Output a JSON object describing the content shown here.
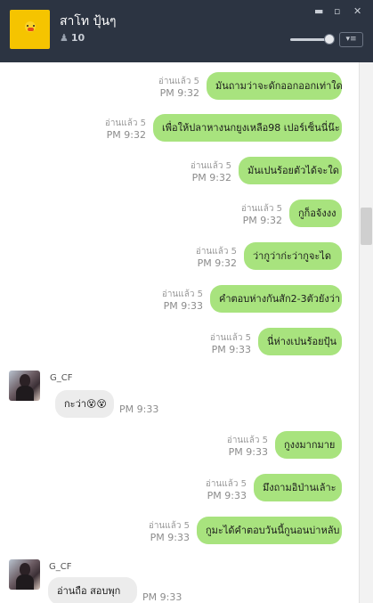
{
  "header": {
    "title": "สาโท ปุ้นๆ",
    "member_count": "10",
    "window_controls": [
      "▬",
      "▫",
      "✕"
    ]
  },
  "messages": [
    {
      "side": "me",
      "text": "มันถามว่าจะดักออกออกเท่าใด",
      "read": "อ่านแล้ว 5",
      "time": "PM 9:32"
    },
    {
      "side": "me",
      "text": "เพื่อให้ปลาหางนกยูงเหลือ98 เปอร์เซ็นนี่น๊ะ",
      "read": "อ่านแล้ว 5",
      "time": "PM 9:32"
    },
    {
      "side": "me",
      "text": "มันเปนร้อยตัวได้จะใด",
      "read": "อ่านแล้ว 5",
      "time": "PM 9:32"
    },
    {
      "side": "me",
      "text": "กูก็อจ้งงง",
      "read": "อ่านแล้ว 5",
      "time": "PM 9:32"
    },
    {
      "side": "me",
      "text": "ว่ากูว่าก่ะว่ากูจะได",
      "read": "อ่านแล้ว 5",
      "time": "PM 9:32"
    },
    {
      "side": "me",
      "text": "คำตอบห่างกันสัก2-3ตัวยังว่า",
      "read": "อ่านแล้ว 5",
      "time": "PM 9:33"
    },
    {
      "side": "me",
      "text": "นี่ห่างเปนร้อยปุ้น",
      "read": "อ่านแล้ว 5",
      "time": "PM 9:33"
    },
    {
      "side": "them",
      "sender": "G_CF",
      "text": "กะว่า😵😵",
      "time": "PM 9:33"
    },
    {
      "side": "me",
      "text": "กูงงมากมาย",
      "read": "อ่านแล้ว 5",
      "time": "PM 9:33"
    },
    {
      "side": "me",
      "text": "มึงถามอิป่านเล้าะ",
      "read": "อ่านแล้ว 5",
      "time": "PM 9:33"
    },
    {
      "side": "me",
      "text": "กูมะได้คำตอบวันนี้กูนอนบ่าหลับ",
      "read": "อ่านแล้ว 5",
      "time": "PM 9:33"
    },
    {
      "side": "them",
      "sender": "G_CF",
      "text": "อ่านถือ สอบพุก",
      "time": "PM 9:33"
    }
  ]
}
